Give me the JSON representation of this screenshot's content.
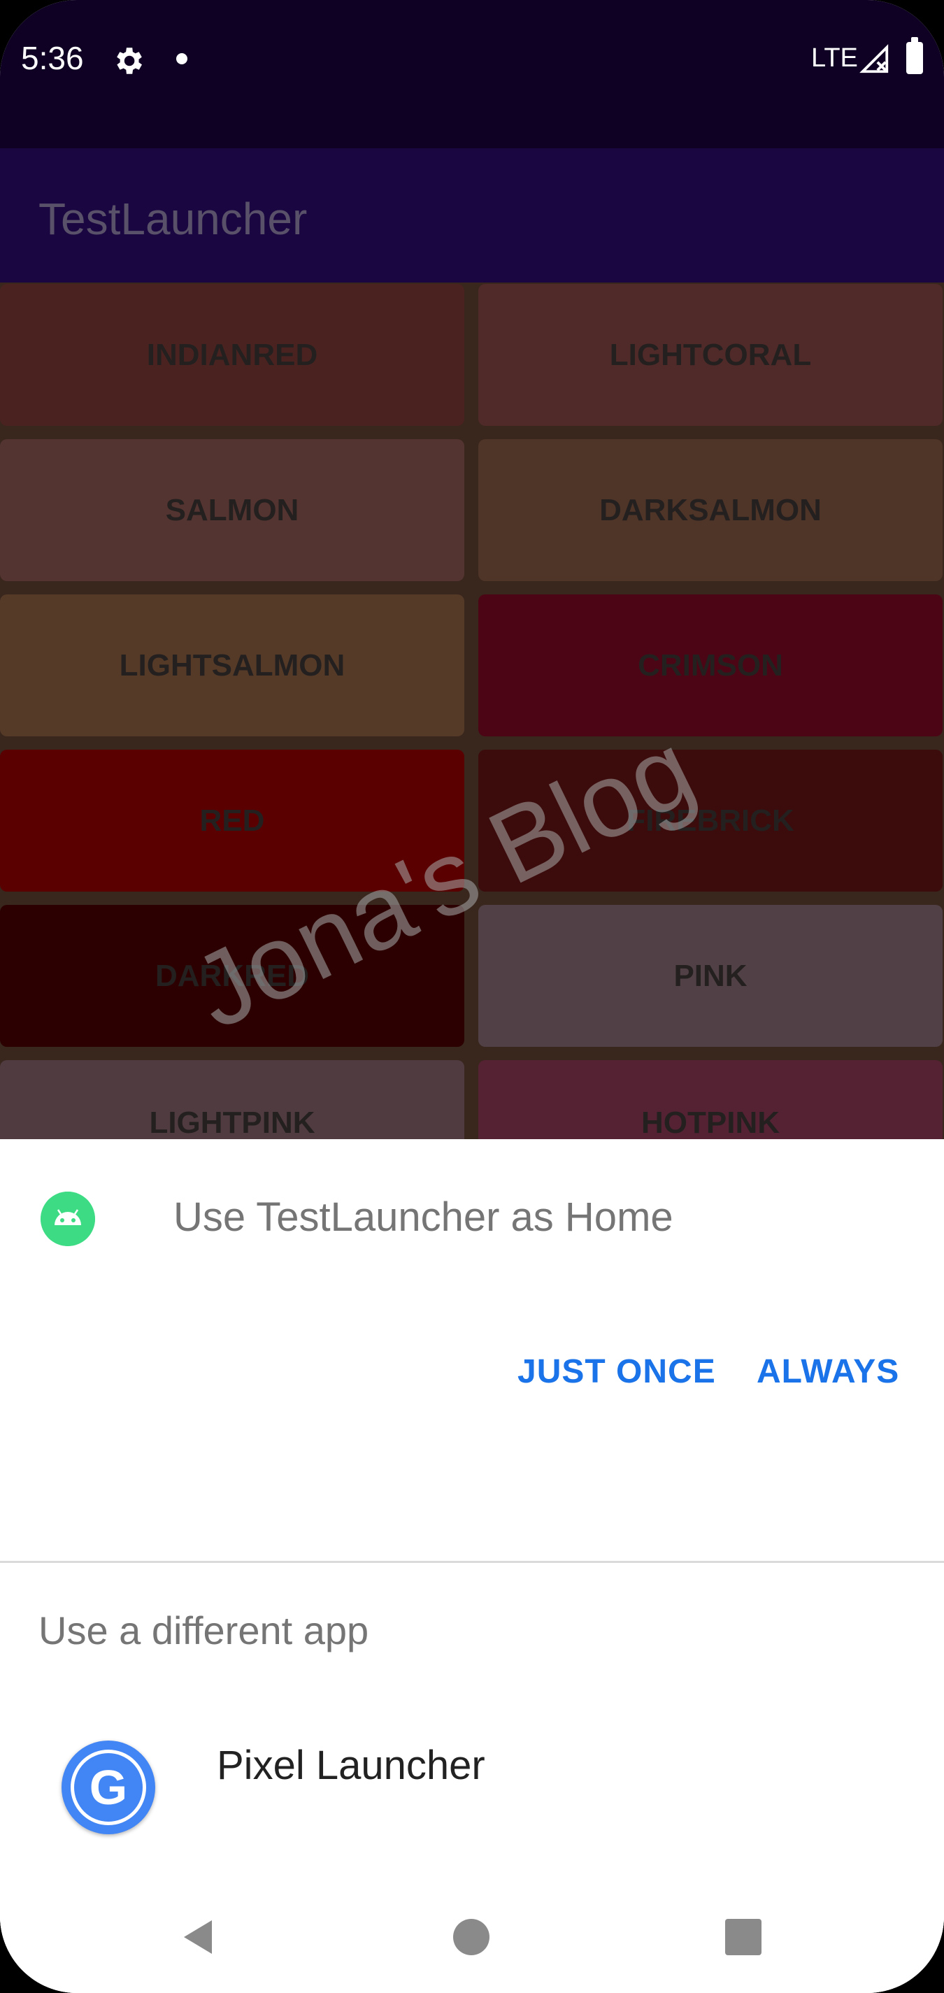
{
  "status_bar": {
    "time": "5:36",
    "network": "LTE",
    "icons": [
      "gear-icon",
      "dot-icon",
      "signal-icon",
      "battery-icon"
    ]
  },
  "app_bar": {
    "title": "TestLauncher"
  },
  "color_tiles": [
    {
      "label": "INDIANRED",
      "color": "#4a2320"
    },
    {
      "label": "LIGHTCORAL",
      "color": "#4f2a28"
    },
    {
      "label": "SALMON",
      "color": "#543430"
    },
    {
      "label": "DARKSALMON",
      "color": "#4f3428"
    },
    {
      "label": "LIGHTSALMON",
      "color": "#553a28"
    },
    {
      "label": "CRIMSON",
      "color": "#4c0514"
    },
    {
      "label": "RED",
      "color": "#5a0000"
    },
    {
      "label": "FIREBRICK",
      "color": "#3c0b0b"
    },
    {
      "label": "DARKRED",
      "color": "#2c0000"
    },
    {
      "label": "PINK",
      "color": "#514146"
    },
    {
      "label": "LIGHTPINK",
      "color": "#503c40"
    },
    {
      "label": "HOTPINK",
      "color": "#552234"
    }
  ],
  "watermark": "Jona's Blog",
  "sheet": {
    "title": "Use TestLauncher as Home",
    "just_once_label": "JUST ONCE",
    "always_label": "ALWAYS",
    "different_app_label": "Use a different app",
    "alternative_app": {
      "name": "Pixel Launcher",
      "icon": "google-g-icon"
    }
  },
  "nav_bar": {
    "icons": [
      "back-icon",
      "home-icon",
      "recents-icon"
    ]
  },
  "colors": {
    "accent": "#1a73e8",
    "status_bar": "#0e0123",
    "app_bar": "#1a0640",
    "android_green": "#3ddc84"
  }
}
